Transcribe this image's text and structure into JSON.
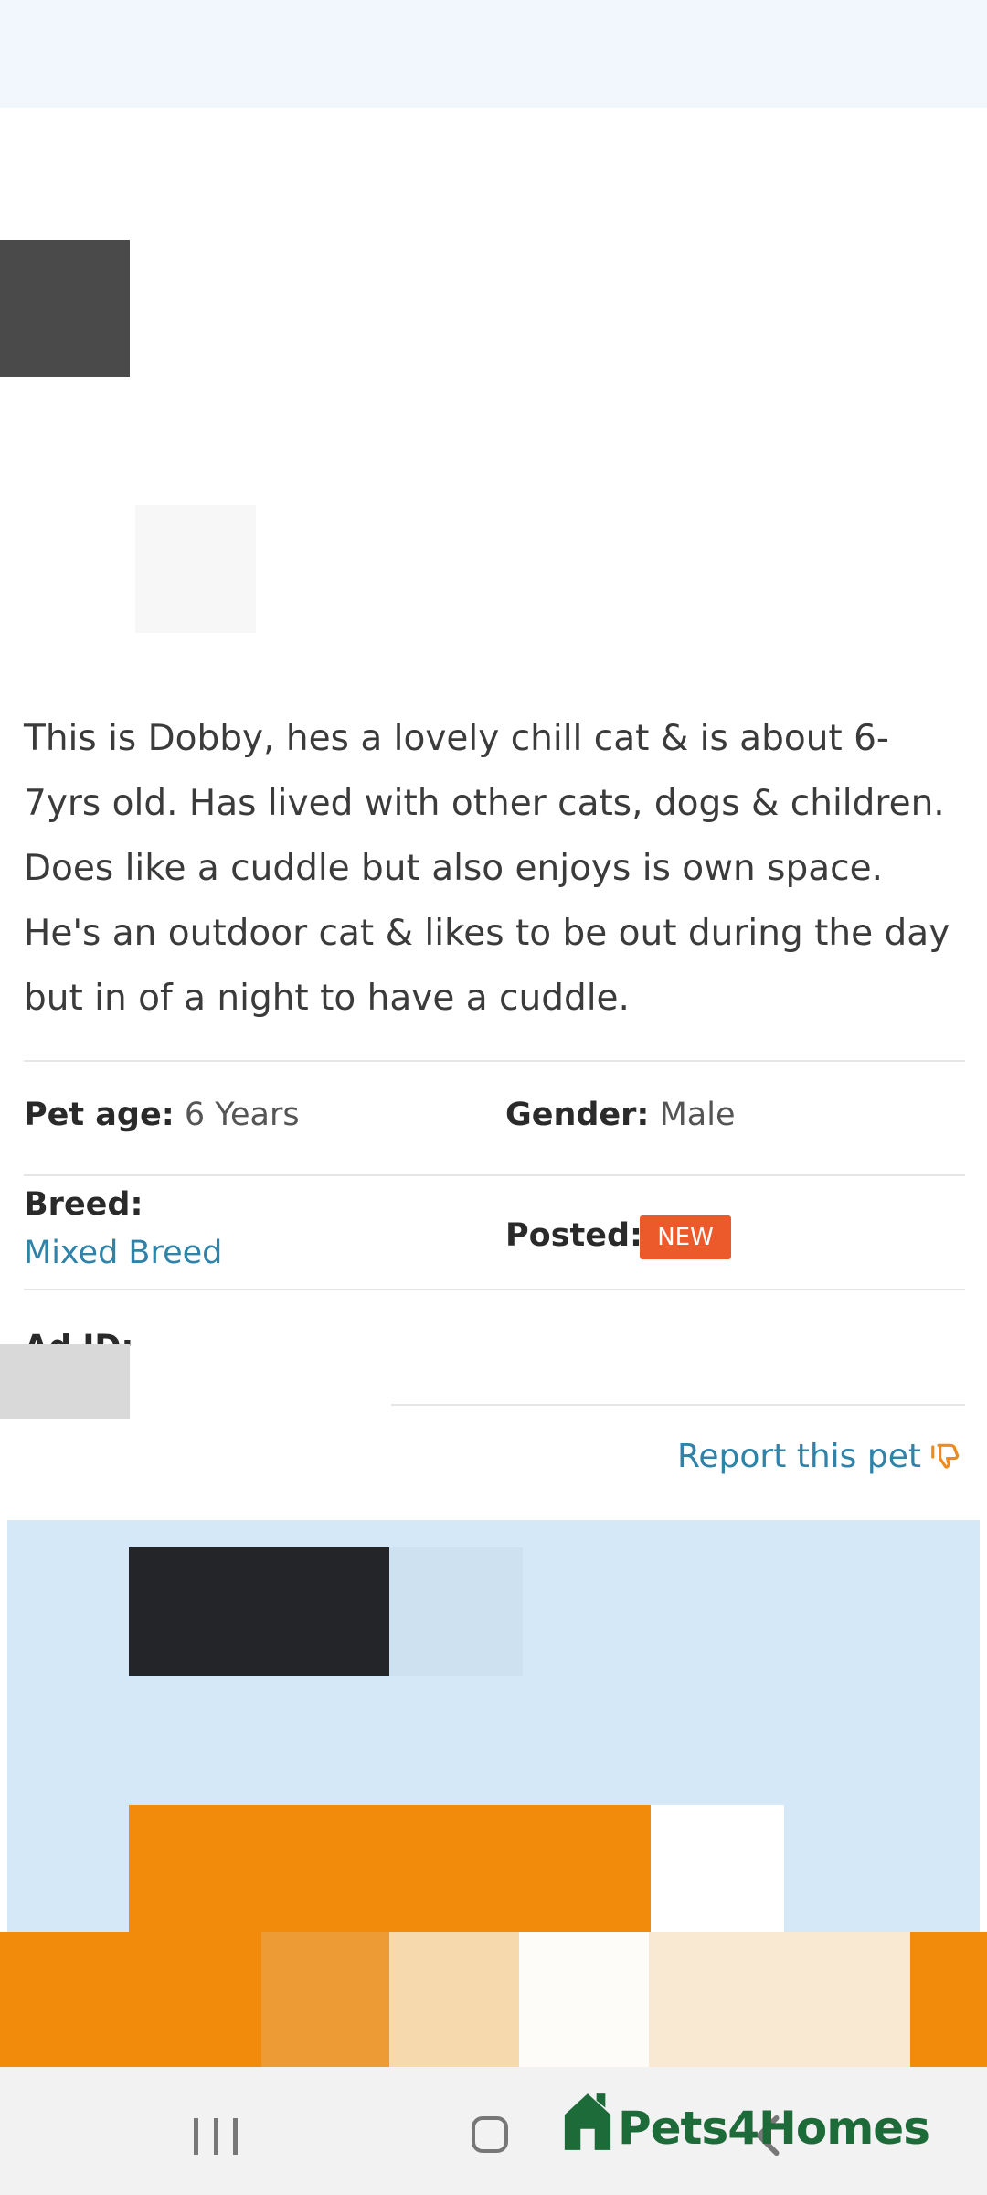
{
  "listing": {
    "description": "This is Dobby, hes a lovely chill cat & is about 6-7yrs old. Has lived with other cats, dogs & children. Does like a cuddle but also enjoys is own space. He's an outdoor cat & likes to be out during the day but in of a night to have a cuddle."
  },
  "details": {
    "pet_age_label": "Pet age:",
    "pet_age_value": "6 Years",
    "gender_label": "Gender:",
    "gender_value": "Male",
    "breed_label": "Breed:",
    "breed_value": "Mixed Breed",
    "posted_label": "Posted:",
    "posted_badge": "NEW",
    "ad_id_label": "Ad ID:"
  },
  "report": {
    "label": "Report this pet",
    "icon": "thumbs-down-icon"
  },
  "footer": {
    "logo_text": "Pets4Homes"
  },
  "colors": {
    "link": "#2f82a8",
    "badge": "#ec5a2b",
    "logo": "#1e6b3a",
    "promo_bg": "#d5e8f8",
    "promo_orange": "#f28a0c"
  }
}
